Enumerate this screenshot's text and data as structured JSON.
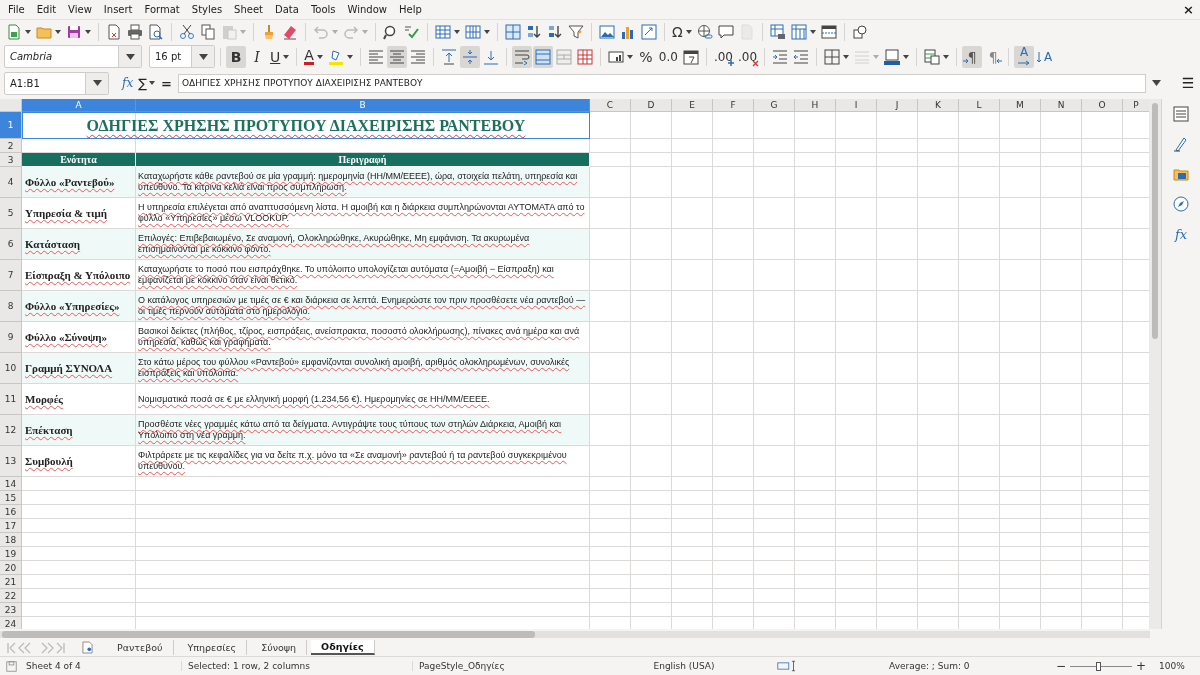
{
  "menu": [
    "File",
    "Edit",
    "View",
    "Insert",
    "Format",
    "Styles",
    "Sheet",
    "Data",
    "Tools",
    "Window",
    "Help"
  ],
  "close": "×",
  "toolbar": [
    {
      "kind": "new-document",
      "dropdown": true,
      "disabled": false
    },
    {
      "kind": "folder",
      "dropdown": true,
      "disabled": false
    },
    {
      "kind": "floppy-disk",
      "dropdown": true,
      "disabled": false
    },
    {
      "kind": "separator"
    },
    {
      "kind": "pdf-document",
      "dropdown": false,
      "disabled": false
    },
    {
      "kind": "printer",
      "dropdown": false,
      "disabled": false
    },
    {
      "kind": "preview-document",
      "dropdown": false,
      "disabled": false
    },
    {
      "kind": "separator"
    },
    {
      "kind": "scissors",
      "dropdown": false,
      "disabled": false
    },
    {
      "kind": "copy",
      "dropdown": false,
      "disabled": false
    },
    {
      "kind": "clipboard",
      "dropdown": true,
      "disabled": true
    },
    {
      "kind": "separator"
    },
    {
      "kind": "paintbrush",
      "dropdown": false,
      "disabled": false
    },
    {
      "kind": "eraser",
      "dropdown": false,
      "disabled": false
    },
    {
      "kind": "separator"
    },
    {
      "kind": "undo",
      "dropdown": true,
      "disabled": true
    },
    {
      "kind": "redo",
      "dropdown": true,
      "disabled": true
    },
    {
      "kind": "separator"
    },
    {
      "kind": "find-replace",
      "dropdown": false,
      "disabled": false
    },
    {
      "kind": "spelling",
      "dropdown": false,
      "disabled": false
    },
    {
      "kind": "separator"
    },
    {
      "kind": "table-rows",
      "dropdown": true,
      "disabled": false
    },
    {
      "kind": "table-columns",
      "dropdown": true,
      "disabled": false
    },
    {
      "kind": "separator"
    },
    {
      "kind": "sort-grid",
      "dropdown": false,
      "disabled": false
    },
    {
      "kind": "sort-ascending",
      "dropdown": false,
      "disabled": false
    },
    {
      "kind": "sort-descending",
      "dropdown": false,
      "disabled": false
    },
    {
      "kind": "funnel",
      "dropdown": false,
      "disabled": false
    },
    {
      "kind": "separator"
    },
    {
      "kind": "image",
      "dropdown": false,
      "disabled": false
    },
    {
      "kind": "bar-chart",
      "dropdown": false,
      "disabled": false
    },
    {
      "kind": "pivot-table",
      "dropdown": false,
      "disabled": false
    },
    {
      "kind": "separator"
    },
    {
      "kind": "special-character",
      "glyph": "Ω",
      "dropdown": true,
      "disabled": false
    },
    {
      "kind": "globe-link",
      "dropdown": false,
      "disabled": false
    },
    {
      "kind": "speech-bubble",
      "dropdown": false,
      "disabled": false
    },
    {
      "kind": "blank-page",
      "dropdown": false,
      "disabled": true
    },
    {
      "kind": "separator"
    },
    {
      "kind": "print-range",
      "dropdown": false,
      "disabled": false
    },
    {
      "kind": "freeze-grid",
      "dropdown": true,
      "disabled": false
    },
    {
      "kind": "split-window",
      "dropdown": false,
      "disabled": false
    },
    {
      "kind": "separator"
    },
    {
      "kind": "shapes",
      "dropdown": false,
      "disabled": false
    }
  ],
  "font": {
    "name": "Cambria",
    "size": "16 pt"
  },
  "format_bar": [
    {
      "kind": "bold",
      "glyph": "B",
      "on": true,
      "dropdown": false,
      "disabled": false
    },
    {
      "kind": "italic",
      "glyph": "I",
      "on": false,
      "dropdown": false,
      "disabled": false
    },
    {
      "kind": "underline",
      "glyph": "U",
      "on": false,
      "dropdown": true,
      "disabled": false
    },
    {
      "kind": "separator"
    },
    {
      "kind": "font-color",
      "glyph": "A",
      "on": false,
      "dropdown": true,
      "disabled": false
    },
    {
      "kind": "highlighter",
      "on": false,
      "dropdown": true,
      "disabled": false
    },
    {
      "kind": "separator"
    },
    {
      "kind": "align-left",
      "on": false,
      "dropdown": false,
      "disabled": false
    },
    {
      "kind": "align-center",
      "on": true,
      "dropdown": false,
      "disabled": false
    },
    {
      "kind": "align-right",
      "on": false,
      "dropdown": false,
      "disabled": false
    },
    {
      "kind": "separator"
    },
    {
      "kind": "align-top",
      "on": false,
      "dropdown": false,
      "disabled": false
    },
    {
      "kind": "align-middle",
      "on": true,
      "dropdown": false,
      "disabled": false
    },
    {
      "kind": "align-bottom",
      "on": false,
      "dropdown": false,
      "disabled": false
    },
    {
      "kind": "separator"
    },
    {
      "kind": "wrap-text",
      "on": true,
      "dropdown": false,
      "disabled": false
    },
    {
      "kind": "merge-cells",
      "on": true,
      "dropdown": false,
      "disabled": false
    },
    {
      "kind": "unmerge-cells",
      "on": false,
      "dropdown": false,
      "disabled": false
    },
    {
      "kind": "table-grid",
      "on": false,
      "dropdown": false,
      "disabled": false
    },
    {
      "kind": "separator"
    },
    {
      "kind": "number-format",
      "on": false,
      "dropdown": true,
      "disabled": false
    },
    {
      "kind": "percent",
      "glyph": "%",
      "on": false,
      "dropdown": false,
      "disabled": false
    },
    {
      "kind": "decimal",
      "glyph": "0.0",
      "on": false,
      "dropdown": false,
      "disabled": false
    },
    {
      "kind": "calendar",
      "on": false,
      "dropdown": false,
      "disabled": false
    },
    {
      "kind": "separator"
    },
    {
      "kind": "add-decimal",
      "glyph": ".00",
      "on": false,
      "dropdown": false,
      "disabled": false
    },
    {
      "kind": "remove-decimal",
      "glyph": ".00",
      "on": false,
      "dropdown": false,
      "disabled": false
    },
    {
      "kind": "separator"
    },
    {
      "kind": "indent",
      "on": false,
      "dropdown": false,
      "disabled": false
    },
    {
      "kind": "outdent",
      "on": false,
      "dropdown": false,
      "disabled": false
    },
    {
      "kind": "separator"
    },
    {
      "kind": "borders",
      "on": false,
      "dropdown": true,
      "disabled": false
    },
    {
      "kind": "border-style",
      "on": false,
      "dropdown": true,
      "disabled": true
    },
    {
      "kind": "border-color",
      "on": false,
      "dropdown": true,
      "disabled": false
    },
    {
      "kind": "separator"
    },
    {
      "kind": "conditional-format",
      "on": false,
      "dropdown": true,
      "disabled": false
    },
    {
      "kind": "separator"
    },
    {
      "kind": "pilcrow-left",
      "glyph": "¶",
      "on": true,
      "dropdown": false,
      "disabled": false
    },
    {
      "kind": "pilcrow-right",
      "glyph": "¶",
      "on": false,
      "dropdown": false,
      "disabled": false
    },
    {
      "kind": "separator"
    },
    {
      "kind": "text-direction",
      "glyph": "A",
      "on": true,
      "dropdown": false,
      "disabled": false
    },
    {
      "kind": "vertical-text",
      "glyph": "A",
      "on": false,
      "dropdown": false,
      "disabled": false
    }
  ],
  "formula_bar": {
    "name_box": "A1:B1",
    "function_wizard": "fx",
    "sum": "∑",
    "equals": "=",
    "formula": "ΟΔΗΓΙΕΣ ΧΡΗΣΗΣ ΠΡΟΤΥΠΟΥ ΔΙΑΧΕΙΡΙΣΗΣ ΡΑΝΤΕΒΟΥ"
  },
  "sidebar": {
    "menu": "☰",
    "decks": [
      {
        "kind": "properties"
      },
      {
        "kind": "styles"
      },
      {
        "kind": "gallery"
      },
      {
        "kind": "navigator"
      },
      {
        "kind": "functions",
        "glyph": "fx"
      }
    ]
  },
  "columns": [
    {
      "label": "A",
      "selected": true
    },
    {
      "label": "B",
      "selected": true
    },
    {
      "label": "C",
      "selected": false
    },
    {
      "label": "D",
      "selected": false
    },
    {
      "label": "E",
      "selected": false
    },
    {
      "label": "F",
      "selected": false
    },
    {
      "label": "G",
      "selected": false
    },
    {
      "label": "H",
      "selected": false
    },
    {
      "label": "I",
      "selected": false
    },
    {
      "label": "J",
      "selected": false
    },
    {
      "label": "K",
      "selected": false
    },
    {
      "label": "L",
      "selected": false
    },
    {
      "label": "M",
      "selected": false
    },
    {
      "label": "N",
      "selected": false
    },
    {
      "label": "O",
      "selected": false
    },
    {
      "label": "P",
      "selected": false
    }
  ],
  "rows": [
    {
      "number": "1",
      "selected": true,
      "kind": "title",
      "cells": [
        "ΟΔΗΓΙΕΣ ΧΡΗΣΗΣ ΠΡΟΤΥΠΟΥ ΔΙΑΧΕΙΡΙΣΗΣ ΡΑΝΤΕΒΟΥ"
      ]
    },
    {
      "number": "2",
      "selected": false,
      "kind": "empty"
    },
    {
      "number": "3",
      "selected": false,
      "kind": "header",
      "cells": [
        "Ενότητα",
        "Περιγραφή"
      ]
    },
    {
      "number": "4",
      "selected": false,
      "kind": "entry",
      "shaded": true,
      "cells": [
        "Φύλλο «Ραντεβού»",
        "Καταχωρήστε κάθε ραντεβού σε μία γραμμή: ημερομηνία (ΗΗ/ΜΜ/ΕΕΕΕ), ώρα, στοιχεία πελάτη, υπηρεσία και υπεύθυνο. Τα κίτρινα κελιά είναι προς συμπλήρωση."
      ]
    },
    {
      "number": "5",
      "selected": false,
      "kind": "entry",
      "shaded": false,
      "cells": [
        "Υπηρεσία & τιμή",
        "Η υπηρεσία επιλέγεται από αναπτυσσόμενη λίστα. Η αμοιβή και η διάρκεια συμπληρώνονται ΑΥΤΟΜΑΤΑ από το φύλλο «Υπηρεσίες» μέσω VLOOKUP."
      ]
    },
    {
      "number": "6",
      "selected": false,
      "kind": "entry",
      "shaded": true,
      "cells": [
        "Κατάσταση",
        "Επιλογές: Επιβεβαιωμένο, Σε αναμονή, Ολοκληρώθηκε, Ακυρώθηκε, Μη εμφάνιση. Τα ακυρωμένα επισημαίνονται με κόκκινο φόντο."
      ]
    },
    {
      "number": "7",
      "selected": false,
      "kind": "entry",
      "shaded": false,
      "cells": [
        "Είσπραξη & Υπόλοιπο",
        "Καταχωρήστε το ποσό που εισπράχθηκε. Το υπόλοιπο υπολογίζεται αυτόματα (=Αμοιβή − Είσπραξη) και εμφανίζεται με κόκκινο όταν είναι θετικό."
      ]
    },
    {
      "number": "8",
      "selected": false,
      "kind": "entry",
      "shaded": true,
      "cells": [
        "Φύλλο «Υπηρεσίες»",
        "Ο κατάλογος υπηρεσιών με τιμές σε € και διάρκεια σε λεπτά. Ενημερώστε τον πριν προσθέσετε νέα ραντεβού — οι τιμές περνούν αυτόματα στο ημερολόγιο."
      ]
    },
    {
      "number": "9",
      "selected": false,
      "kind": "entry",
      "shaded": false,
      "cells": [
        "Φύλλο «Σύνοψη»",
        "Βασικοί δείκτες (πλήθος, τζίρος, εισπράξεις, ανείσπρακτα, ποσοστό ολοκλήρωσης), πίνακες ανά ημέρα και ανά υπηρεσία, καθώς και γραφήματα."
      ]
    },
    {
      "number": "10",
      "selected": false,
      "kind": "entry",
      "shaded": true,
      "cells": [
        "Γραμμή ΣΥΝΟΛΑ",
        "Στο κάτω μέρος του φύλλου «Ραντεβού» εμφανίζονται συνολική αμοιβή, αριθμός ολοκληρωμένων, συνολικές εισπράξεις και υπόλοιπα."
      ]
    },
    {
      "number": "11",
      "selected": false,
      "kind": "entry",
      "shaded": false,
      "cells": [
        "Μορφές",
        "Νομισματικά ποσά σε € με ελληνική μορφή (1.234,56 €). Ημερομηνίες σε ΗΗ/ΜΜ/ΕΕΕΕ."
      ]
    },
    {
      "number": "12",
      "selected": false,
      "kind": "entry",
      "shaded": true,
      "cells": [
        "Επέκταση",
        "Προσθέστε νέες γραμμές κάτω από τα δείγματα. Αντιγράψτε τους τύπους των στηλών Διάρκεια, Αμοιβή και Υπόλοιπο στη νέα γραμμή."
      ]
    },
    {
      "number": "13",
      "selected": false,
      "kind": "entry",
      "shaded": false,
      "cells": [
        "Συμβουλή",
        "Φιλτράρετε με τις κεφαλίδες για να δείτε π.χ. μόνο τα «Σε αναμονή» ραντεβού ή τα ραντεβού συγκεκριμένου υπεύθυνου."
      ]
    },
    {
      "number": "14",
      "selected": false,
      "kind": "empty"
    },
    {
      "number": "15",
      "selected": false,
      "kind": "empty"
    },
    {
      "number": "16",
      "selected": false,
      "kind": "empty"
    },
    {
      "number": "17",
      "selected": false,
      "kind": "empty"
    },
    {
      "number": "18",
      "selected": false,
      "kind": "empty"
    },
    {
      "number": "19",
      "selected": false,
      "kind": "empty"
    },
    {
      "number": "20",
      "selected": false,
      "kind": "empty"
    },
    {
      "number": "21",
      "selected": false,
      "kind": "empty"
    },
    {
      "number": "22",
      "selected": false,
      "kind": "empty"
    },
    {
      "number": "23",
      "selected": false,
      "kind": "empty"
    },
    {
      "number": "24",
      "selected": false,
      "kind": "empty"
    }
  ],
  "sheets": [
    {
      "label": "Ραντεβού",
      "selected": false
    },
    {
      "label": "Υπηρεσίες",
      "selected": false
    },
    {
      "label": "Σύνοψη",
      "selected": false
    },
    {
      "label": "Οδηγίες",
      "selected": true
    }
  ],
  "status": {
    "sheet": "Sheet 4 of 4",
    "selection": "Selected: 1 row, 2 columns",
    "page_style": "PageStyle_Οδηγίες",
    "language": "English (USA)",
    "sum": "Average: ; Sum: 0",
    "zoom_minus": "−",
    "zoom_plus": "+",
    "zoom_slider": {
      "level": 0.45
    },
    "zoom": "100%"
  }
}
